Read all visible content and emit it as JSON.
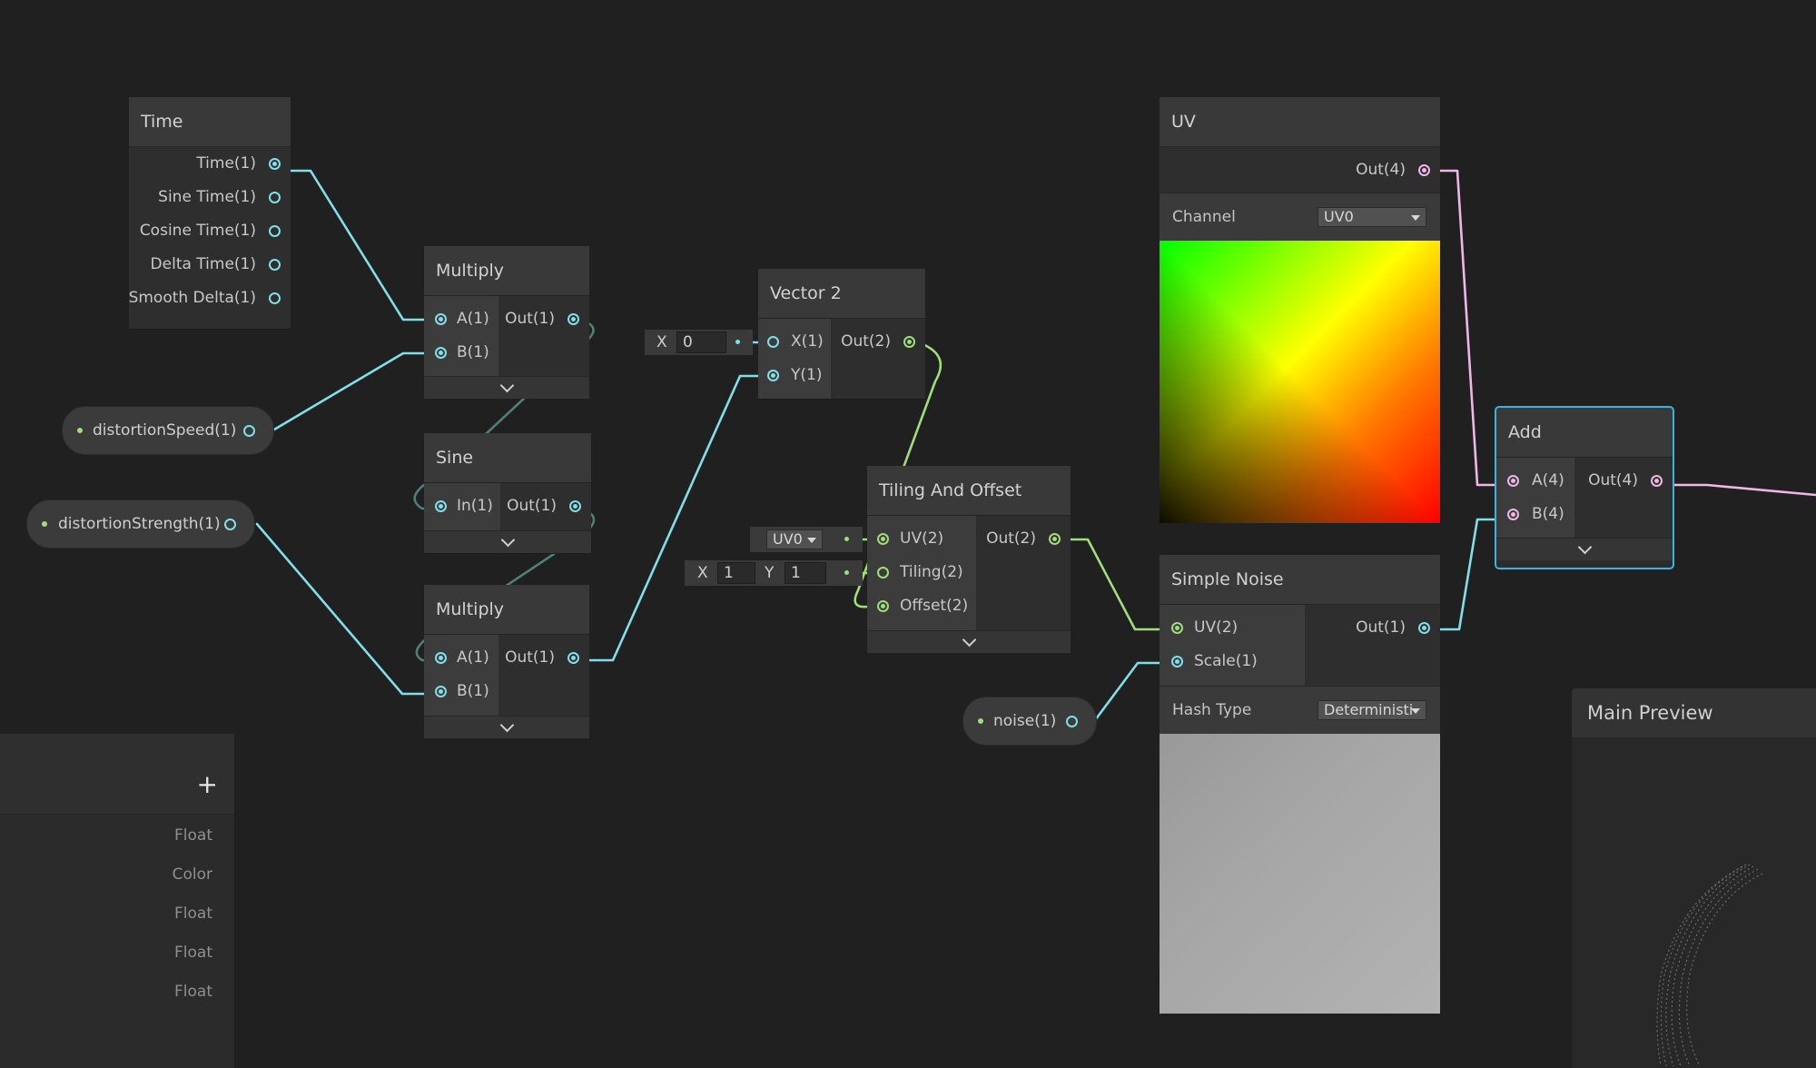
{
  "nodes": {
    "time": {
      "title": "Time",
      "outputs": [
        "Time(1)",
        "Sine Time(1)",
        "Cosine Time(1)",
        "Delta Time(1)",
        "Smooth Delta(1)"
      ]
    },
    "multiply1": {
      "title": "Multiply",
      "inputs": [
        "A(1)",
        "B(1)"
      ],
      "output": "Out(1)"
    },
    "sine": {
      "title": "Sine",
      "input": "In(1)",
      "output": "Out(1)"
    },
    "multiply2": {
      "title": "Multiply",
      "inputs": [
        "A(1)",
        "B(1)"
      ],
      "output": "Out(1)"
    },
    "vector2": {
      "title": "Vector 2",
      "inputs": [
        "X(1)",
        "Y(1)"
      ],
      "output": "Out(2)",
      "x_label": "X",
      "x_value": "0"
    },
    "tiling": {
      "title": "Tiling And Offset",
      "inputs": [
        "UV(2)",
        "Tiling(2)",
        "Offset(2)"
      ],
      "output": "Out(2)",
      "uv_value": "UV0",
      "tiling_x_label": "X",
      "tiling_x": "1",
      "tiling_y_label": "Y",
      "tiling_y": "1"
    },
    "uv": {
      "title": "UV",
      "output": "Out(4)",
      "channel_label": "Channel",
      "channel_value": "UV0"
    },
    "simple_noise": {
      "title": "Simple Noise",
      "inputs": [
        "UV(2)",
        "Scale(1)"
      ],
      "output": "Out(1)",
      "hash_label": "Hash Type",
      "hash_value": "Deterministi"
    },
    "add": {
      "title": "Add",
      "inputs": [
        "A(4)",
        "B(4)"
      ],
      "output": "Out(4)"
    }
  },
  "properties": {
    "distortion_speed": "distortionSpeed(1)",
    "distortion_strength": "distortionStrength(1)",
    "noise": "noise(1)"
  },
  "blackboard": {
    "add_label": "+",
    "types": [
      "Float",
      "Color",
      "Float",
      "Float",
      "Float"
    ]
  },
  "main_preview": {
    "title": "Main Preview"
  },
  "colors": {
    "float": "#7fe0ea",
    "vector2": "#9edf7a",
    "vector4": "#f0b7e6",
    "selected": "#3ab3e0"
  }
}
